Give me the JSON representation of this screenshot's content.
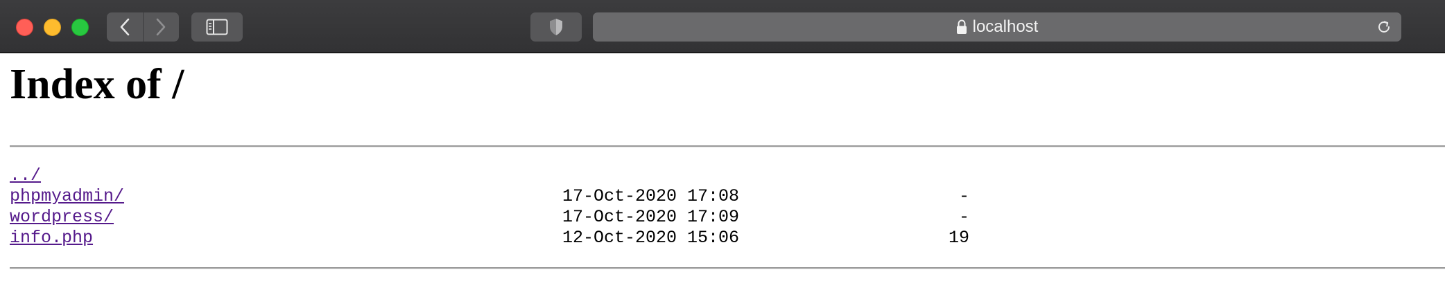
{
  "browser": {
    "address": "localhost",
    "icons": {
      "back": "chevron-left-icon",
      "forward": "chevron-right-icon",
      "sidebar": "sidebar-icon",
      "shield": "shield-icon",
      "lock": "lock-icon",
      "reload": "reload-icon"
    },
    "colors": {
      "toolbar": "#353537",
      "close": "#ff5f57",
      "minimize": "#febc2e",
      "zoom": "#28c840"
    }
  },
  "page": {
    "title": "Index of /",
    "link_color": "#551a8b",
    "entries": [
      {
        "name": "../",
        "date": "",
        "size": ""
      },
      {
        "name": "phpmyadmin/",
        "date": "17-Oct-2020 17:08",
        "size": "-"
      },
      {
        "name": "wordpress/",
        "date": "17-Oct-2020 17:09",
        "size": "-"
      },
      {
        "name": "info.php",
        "date": "12-Oct-2020 15:06",
        "size": "19"
      }
    ]
  }
}
